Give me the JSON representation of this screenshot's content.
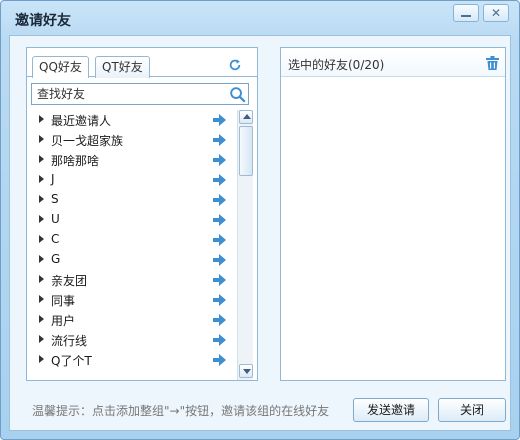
{
  "window": {
    "title": "邀请好友",
    "minimize_symbol": "",
    "close_symbol": "✕"
  },
  "tabs": [
    {
      "label": "QQ好友",
      "active": true
    },
    {
      "label": "QT好友",
      "active": false
    }
  ],
  "icons": {
    "refresh": "refresh-icon",
    "search": "search-icon",
    "add_arrow": "arrow-right-icon",
    "trash": "trash-icon"
  },
  "search": {
    "placeholder": "查找好友",
    "value": ""
  },
  "groups": [
    {
      "label": "最近邀请人"
    },
    {
      "label": "贝一戈超家族"
    },
    {
      "label": "那啥那啥"
    },
    {
      "label": "J"
    },
    {
      "label": "S"
    },
    {
      "label": "U"
    },
    {
      "label": "C"
    },
    {
      "label": "G"
    },
    {
      "label": "亲友团"
    },
    {
      "label": "同事"
    },
    {
      "label": "用户"
    },
    {
      "label": "流行线"
    },
    {
      "label": "Q了个T"
    }
  ],
  "selected_panel": {
    "title": "选中的好友(0/20)"
  },
  "footer": {
    "tip": "温馨提示：点击添加整组\"→\"按钮，邀请该组的在线好友",
    "send_label": "发送邀请",
    "close_label": "关闭"
  },
  "colors": {
    "accent": "#3d8fd1",
    "border": "#93b8d6"
  }
}
